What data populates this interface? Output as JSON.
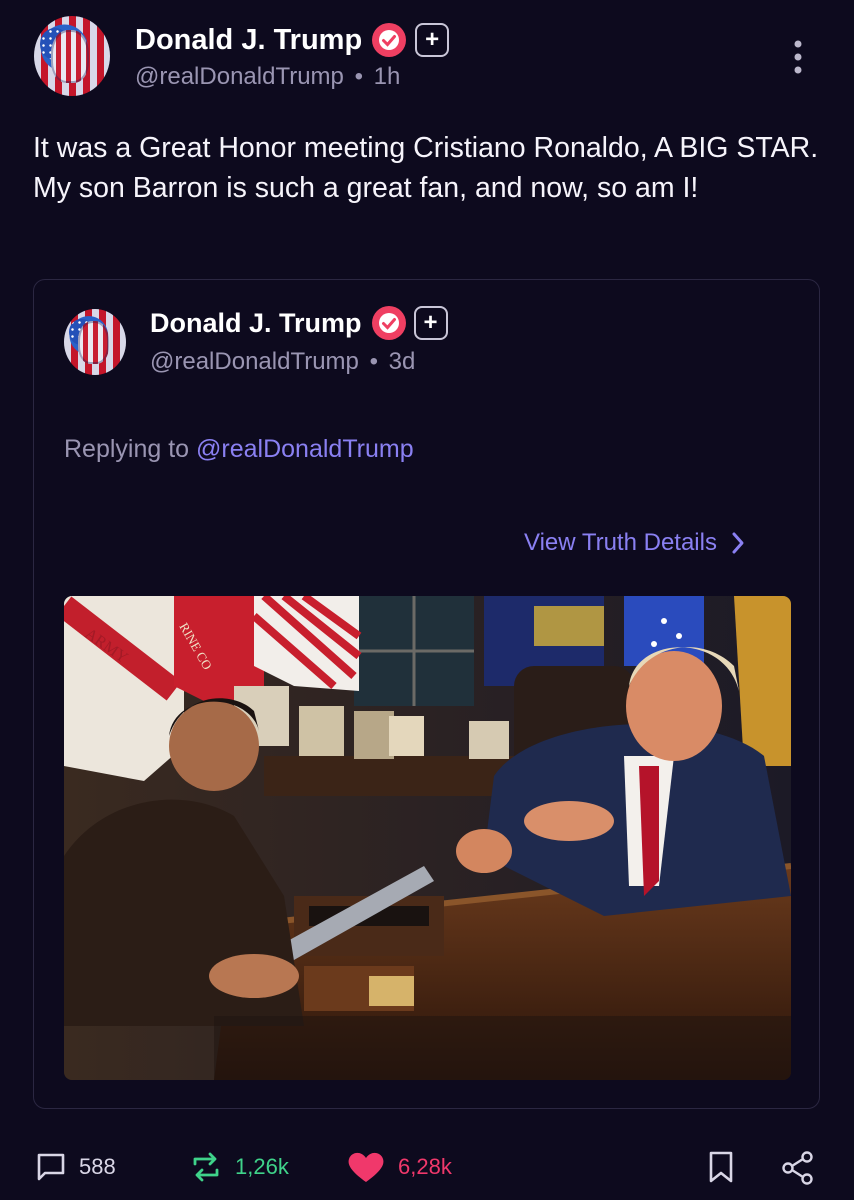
{
  "post": {
    "author_name": "Donald J. Trump",
    "handle": "@realDonaldTrump",
    "separator": "•",
    "time": "1h",
    "plus_label": "+",
    "body": "It was a Great Honor meeting Cristiano Ronaldo, A BIG STAR. My son Barron is such a great fan, and now, so am I!"
  },
  "quoted": {
    "author_name": "Donald J. Trump",
    "handle": "@realDonaldTrump",
    "separator": "•",
    "time": "3d",
    "plus_label": "+",
    "replying_prefix": "Replying to",
    "replying_handle": "@realDonaldTrump",
    "view_details": "View Truth Details",
    "photo_flag_text_1": "ARMY",
    "photo_flag_text_2": "RINE CO"
  },
  "actions": {
    "replies": "588",
    "retruths": "1,26k",
    "likes": "6,28k"
  },
  "colors": {
    "background": "#0d0a1e",
    "accent": "#8a80f2",
    "verified": "#ef3f62",
    "retruth": "#3fd38a",
    "like": "#f0386b"
  },
  "icons": [
    "more-vertical-icon",
    "verified-icon",
    "plus-icon",
    "chevron-right-icon",
    "comment-icon",
    "retruth-icon",
    "heart-icon",
    "bookmark-icon",
    "share-icon"
  ]
}
